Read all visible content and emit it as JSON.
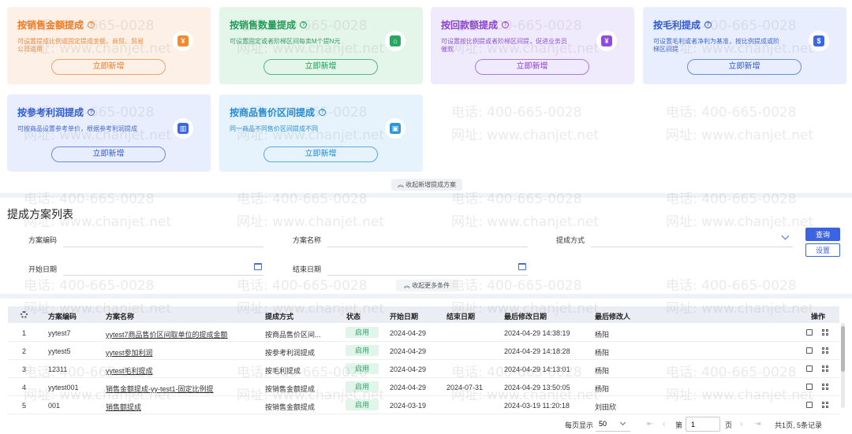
{
  "cards": [
    {
      "title": "按销售金额提成",
      "desc": "可设置提成比例或固定提成金额，商贸、贸易公司适用",
      "button": "立即新增",
      "icon": "money-bag-icon",
      "color": "#f27a1f"
    },
    {
      "title": "按销售数量提成",
      "desc": "可设置固定或者阶梯区间每卖M个提N元",
      "button": "立即新增",
      "icon": "box-arrow-icon",
      "color": "#1a9e55"
    },
    {
      "title": "按回款额提成",
      "desc": "可设置按比例提或者阶梯区间提，促进业务员催款",
      "button": "立即新增",
      "icon": "calendar-money-icon",
      "color": "#8a3fd4"
    },
    {
      "title": "按毛利提成",
      "desc": "可设置毛利或者净利为基准，按比例提成或阶梯区间提",
      "button": "立即新增",
      "icon": "coin-bag-icon",
      "color": "#2c58d8"
    },
    {
      "title": "按参考利润提成",
      "desc": "可按商品设置参考单价，根据参考利润提成",
      "button": "立即新增",
      "icon": "chart-icon",
      "color": "#2c58d8"
    },
    {
      "title": "按商品售价区间提成",
      "desc": "同一商品不同售价区间提成不同",
      "button": "立即新增",
      "icon": "shopping-bag-icon",
      "color": "#1d8bd6"
    }
  ],
  "collapse_top": "收起新增提成方案",
  "list_title": "提成方案列表",
  "filters": {
    "code_label": "方案编码",
    "name_label": "方案名称",
    "method_label": "提成方式",
    "start_label": "开始日期",
    "end_label": "结束日期",
    "code_value": "",
    "name_value": "",
    "method_value": "",
    "start_value": "",
    "end_value": "",
    "query_button": "查询",
    "settings_button": "设置",
    "collapse_more": "收起更多条件"
  },
  "table": {
    "headers": [
      "方案编码",
      "方案名称",
      "提成方式",
      "状态",
      "开始日期",
      "结束日期",
      "最后修改日期",
      "最后修改人",
      "操作"
    ],
    "rows": [
      {
        "no": "1",
        "code": "yytest7",
        "name": "yytest7商品售价区间取单位的提成金额",
        "method": "按商品售价区间...",
        "status": "启用",
        "start": "2024-04-29",
        "end": "",
        "modified": "2024-04-29 14:38:19",
        "modifier": "杨阳"
      },
      {
        "no": "2",
        "code": "yytest5",
        "name": "yytest参加利润",
        "method": "按参考利润提成",
        "status": "启用",
        "start": "2024-04-29",
        "end": "",
        "modified": "2024-04-29 14:18:28",
        "modifier": "杨阳"
      },
      {
        "no": "3",
        "code": "12311",
        "name": "yytest毛利提成",
        "method": "按毛利提成",
        "status": "启用",
        "start": "2024-04-29",
        "end": "",
        "modified": "2024-04-29 14:13:01",
        "modifier": "杨阳"
      },
      {
        "no": "4",
        "code": "yytest001",
        "name": "销售金额提成-yy-test1-固定比例提",
        "method": "按销售金额提成",
        "status": "启用",
        "start": "2024-04-29",
        "end": "2024-07-31",
        "modified": "2024-04-29 13:50:05",
        "modifier": "杨阳"
      },
      {
        "no": "5",
        "code": "001",
        "name": "销售额提成",
        "method": "按销售金额提成",
        "status": "启用",
        "start": "2024-03-19",
        "end": "",
        "modified": "2024-03-19 11:20:18",
        "modifier": "刘田欣"
      }
    ]
  },
  "pager": {
    "per_page_label": "每页显示",
    "per_page_value": "50",
    "page_prefix": "第",
    "page_value": "1",
    "page_suffix": "页",
    "summary": "共1页, 5条记录"
  },
  "watermark": {
    "phone": "电话: 400-665-0028",
    "site": "网址: www.chanjet.net"
  }
}
